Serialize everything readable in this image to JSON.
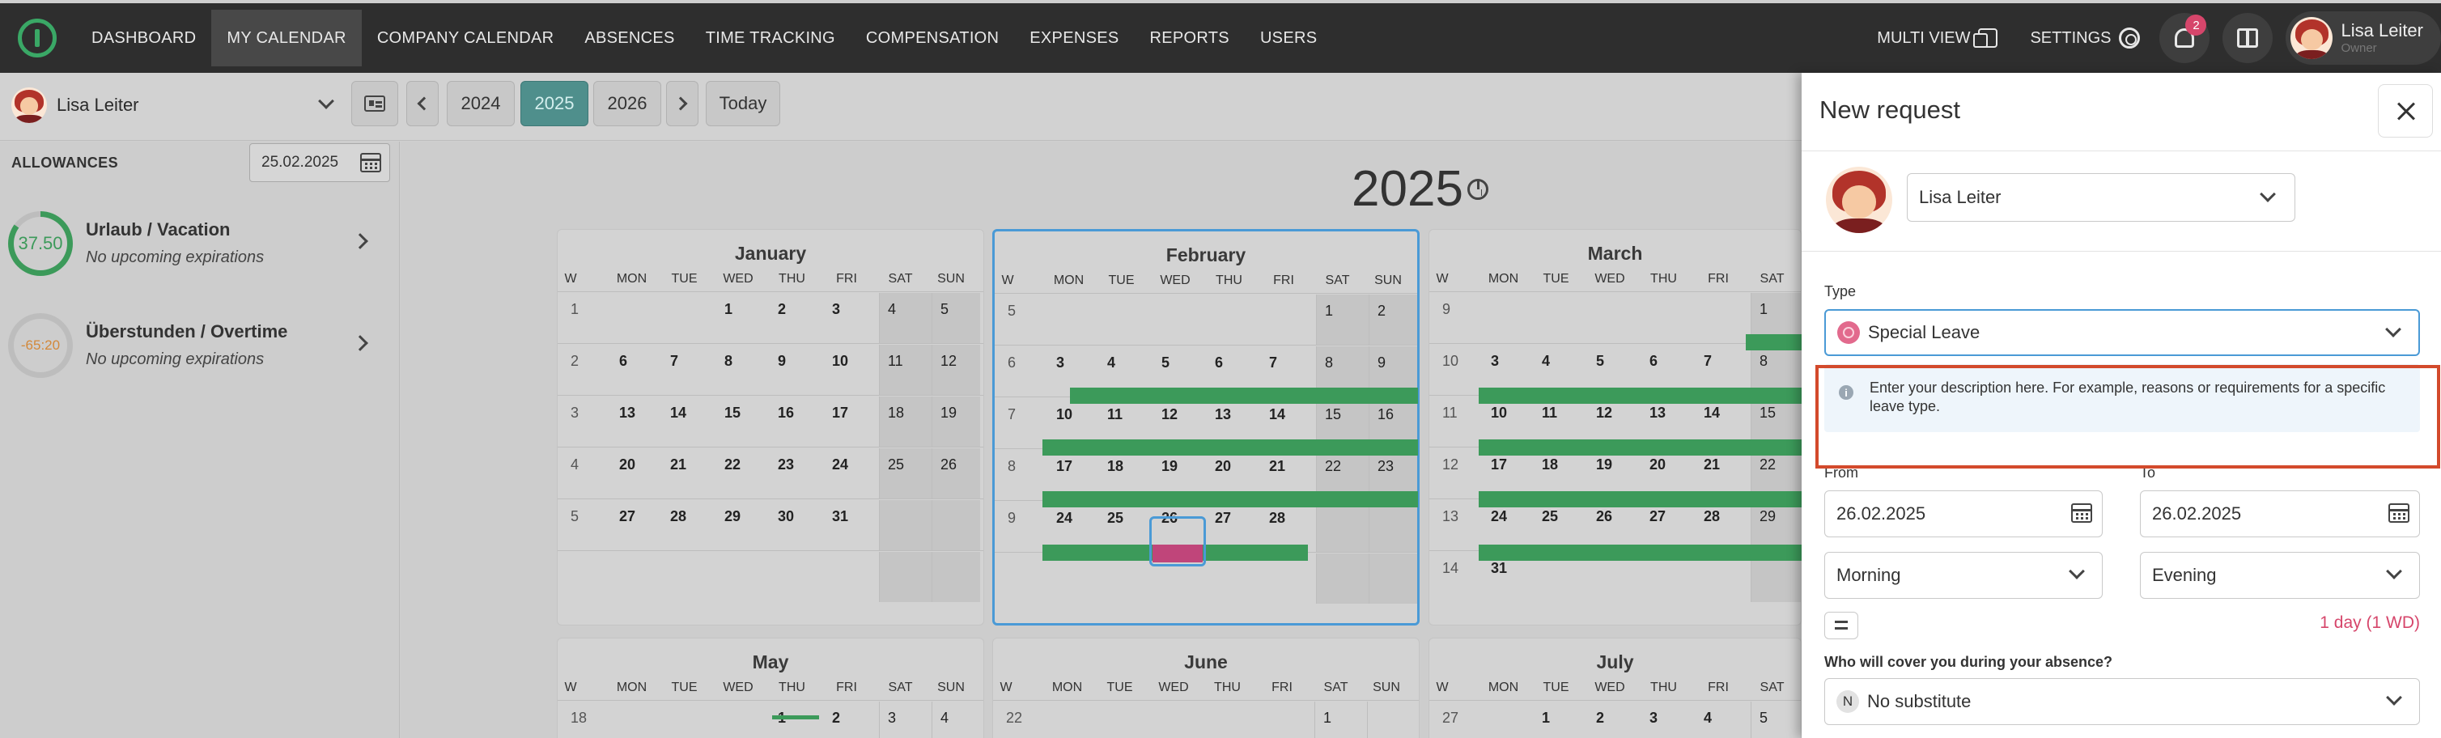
{
  "nav": {
    "items": [
      "DASHBOARD",
      "MY CALENDAR",
      "COMPANY CALENDAR",
      "ABSENCES",
      "TIME TRACKING",
      "COMPENSATION",
      "EXPENSES",
      "REPORTS",
      "USERS"
    ],
    "multi_view": "MULTI VIEW",
    "settings": "SETTINGS",
    "notification_count": "2",
    "user_name": "Lisa Leiter",
    "user_role": "Owner"
  },
  "toolbar": {
    "user": "Lisa Leiter",
    "years": [
      "2024",
      "2025",
      "2026"
    ],
    "prev": "‹",
    "next": "›",
    "today": "Today"
  },
  "allowances": {
    "title": "ALLOWANCES",
    "date": "25.02.2025",
    "items": [
      {
        "value": "37.50",
        "title": "Urlaub / Vacation",
        "subtitle": "No upcoming expirations",
        "color": "#3c9a5a",
        "fill": 0.85
      },
      {
        "value": "-65:20",
        "title": "Überstunden / Overtime",
        "subtitle": "No upcoming expirations",
        "color": "#d3883a",
        "fill": 0.0
      }
    ]
  },
  "calendar": {
    "year": "2025",
    "weekday_headers": [
      "W",
      "MON",
      "TUE",
      "WED",
      "THU",
      "FRI",
      "SAT",
      "SUN"
    ],
    "months": [
      {
        "name": "January",
        "weeks": [
          [
            "1",
            "",
            "",
            "1",
            "2",
            "3",
            "4",
            "5"
          ],
          [
            "2",
            "6",
            "7",
            "8",
            "9",
            "10",
            "11",
            "12"
          ],
          [
            "3",
            "13",
            "14",
            "15",
            "16",
            "17",
            "18",
            "19"
          ],
          [
            "4",
            "20",
            "21",
            "22",
            "23",
            "24",
            "25",
            "26"
          ],
          [
            "5",
            "27",
            "28",
            "29",
            "30",
            "31",
            "",
            ""
          ],
          [
            "",
            "",
            "",
            "",
            "",
            "",
            "",
            ""
          ]
        ]
      },
      {
        "name": "February",
        "weeks": [
          [
            "5",
            "",
            "",
            "",
            "",
            "",
            "1",
            "2"
          ],
          [
            "6",
            "3",
            "4",
            "5",
            "6",
            "7",
            "8",
            "9"
          ],
          [
            "7",
            "10",
            "11",
            "12",
            "13",
            "14",
            "15",
            "16"
          ],
          [
            "8",
            "17",
            "18",
            "19",
            "20",
            "21",
            "22",
            "23"
          ],
          [
            "9",
            "24",
            "25",
            "26",
            "27",
            "28",
            "",
            ""
          ],
          [
            "",
            "",
            "",
            "",
            "",
            "",
            "",
            ""
          ]
        ]
      },
      {
        "name": "March",
        "weeks": [
          [
            "9",
            "",
            "",
            "",
            "",
            "",
            "1",
            ""
          ],
          [
            "10",
            "3",
            "4",
            "5",
            "6",
            "7",
            "8",
            ""
          ],
          [
            "11",
            "10",
            "11",
            "12",
            "13",
            "14",
            "15",
            ""
          ],
          [
            "12",
            "17",
            "18",
            "19",
            "20",
            "21",
            "22",
            ""
          ],
          [
            "13",
            "24",
            "25",
            "26",
            "27",
            "28",
            "29",
            ""
          ],
          [
            "14",
            "31",
            "",
            "",
            "",
            "",
            "",
            ""
          ]
        ]
      },
      {
        "name": "May",
        "weeks": [
          [
            "18",
            "",
            "",
            "",
            "1",
            "2",
            "3",
            "4"
          ]
        ]
      },
      {
        "name": "June",
        "weeks": [
          [
            "22",
            "",
            "",
            "",
            "",
            "",
            "1",
            ""
          ]
        ]
      },
      {
        "name": "July",
        "weeks": [
          [
            "27",
            "",
            "1",
            "2",
            "3",
            "4",
            "5",
            ""
          ]
        ]
      }
    ]
  },
  "panel": {
    "title": "New request",
    "user": "Lisa Leiter",
    "type_label": "Type",
    "type_value": "Special Leave",
    "info_text": "Enter your description here. For example, reasons or requirements for a specific leave type.",
    "from_label": "From",
    "to_label": "To",
    "from_date": "26.02.2025",
    "to_date": "26.02.2025",
    "from_part": "Morning",
    "to_part": "Evening",
    "duration": "1 day (1 WD)",
    "cover_label": "Who will cover you during your absence?",
    "cover_badge": "N",
    "cover_value": "No substitute",
    "colors": {
      "type_icon": "#e26a8d",
      "duration": "#d6466b",
      "highlight_frame": "#d34a2c",
      "selected_year": "#4f8f8c",
      "leave_bar": "#3c9a5a",
      "today_border": "#4a9ad6"
    }
  }
}
